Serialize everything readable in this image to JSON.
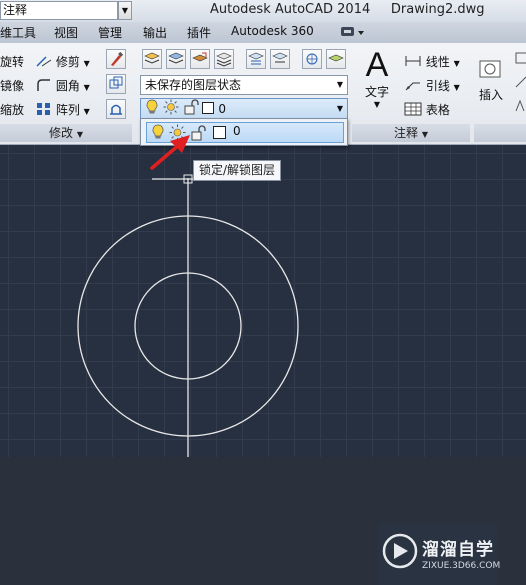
{
  "titlebar": {
    "workspace": "注释",
    "app_title": "Autodesk AutoCAD 2014",
    "file_name": "Drawing2.dwg"
  },
  "tabs": [
    "维工具",
    "视图",
    "管理",
    "输出",
    "插件",
    "Autodesk 360"
  ],
  "modify_panel": {
    "rotate": "旋转",
    "trim": "修剪",
    "mirror": "镜像",
    "fillet": "圆角",
    "scale": "缩放",
    "array": "阵列",
    "title": "修改"
  },
  "layers_panel": {
    "state_combo": "未保存的图层状态",
    "layer_value": "0",
    "dropdown_layer": "0"
  },
  "annotation_panel": {
    "text": "文字",
    "linear": "线性",
    "leader": "引线",
    "table": "表格",
    "title": "注释"
  },
  "insert_panel": {
    "insert": "插入"
  },
  "tooltip": "锁定/解锁图层",
  "watermark": {
    "name": "溜溜自学",
    "url": "ZIXUE.3D66.COM"
  },
  "colors": {
    "canvas": "#273040",
    "accent": "#e02020",
    "highlight": "#bcd9f5"
  }
}
